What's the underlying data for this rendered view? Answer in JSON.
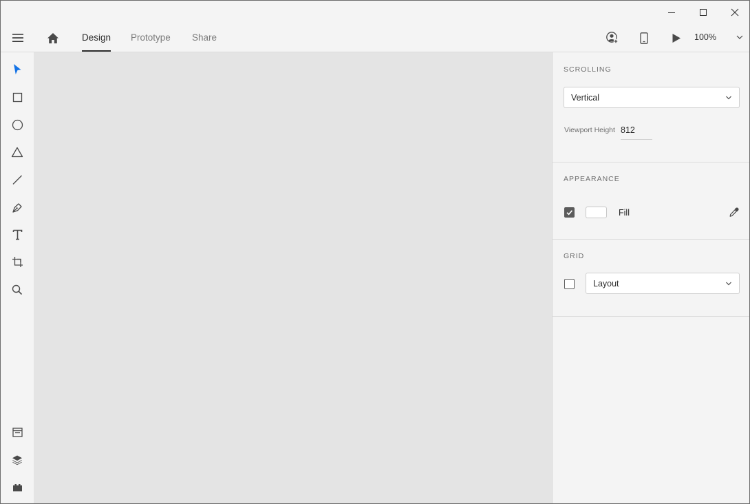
{
  "window": {
    "controls": {
      "minimize_icon": "minimize-icon",
      "maximize_icon": "maximize-icon",
      "close_icon": "close-icon"
    }
  },
  "appbar": {
    "menu_icon": "hamburger-menu-icon",
    "home_icon": "home-icon",
    "tabs": [
      {
        "label": "Design",
        "active": true
      },
      {
        "label": "Prototype",
        "active": false
      },
      {
        "label": "Share",
        "active": false
      }
    ],
    "right_icons": [
      "invite-user-icon",
      "mobile-preview-icon",
      "play-icon"
    ],
    "zoom": "100%"
  },
  "toolbar": {
    "tools": [
      "select-icon",
      "rectangle-icon",
      "ellipse-icon",
      "polygon-icon",
      "line-icon",
      "pen-icon",
      "text-icon",
      "artboard-icon",
      "zoom-icon"
    ],
    "bottom": [
      "assets-icon",
      "layers-icon",
      "plugins-icon"
    ],
    "active_color": "#1473e6"
  },
  "panel": {
    "scrolling": {
      "title": "SCROLLING",
      "dropdown_value": "Vertical",
      "viewport_label": "Viewport Height",
      "viewport_value": "812"
    },
    "appearance": {
      "title": "APPEARANCE",
      "fill_checked": true,
      "fill_label": "Fill",
      "fill_color": "#ffffff",
      "eyedropper_icon": "eyedropper-icon"
    },
    "grid": {
      "title": "GRID",
      "grid_checked": false,
      "dropdown_value": "Layout"
    }
  },
  "colors": {
    "chrome": "#f4f4f4",
    "canvas": "#e4e4e4",
    "text": "#2c2c2c"
  }
}
